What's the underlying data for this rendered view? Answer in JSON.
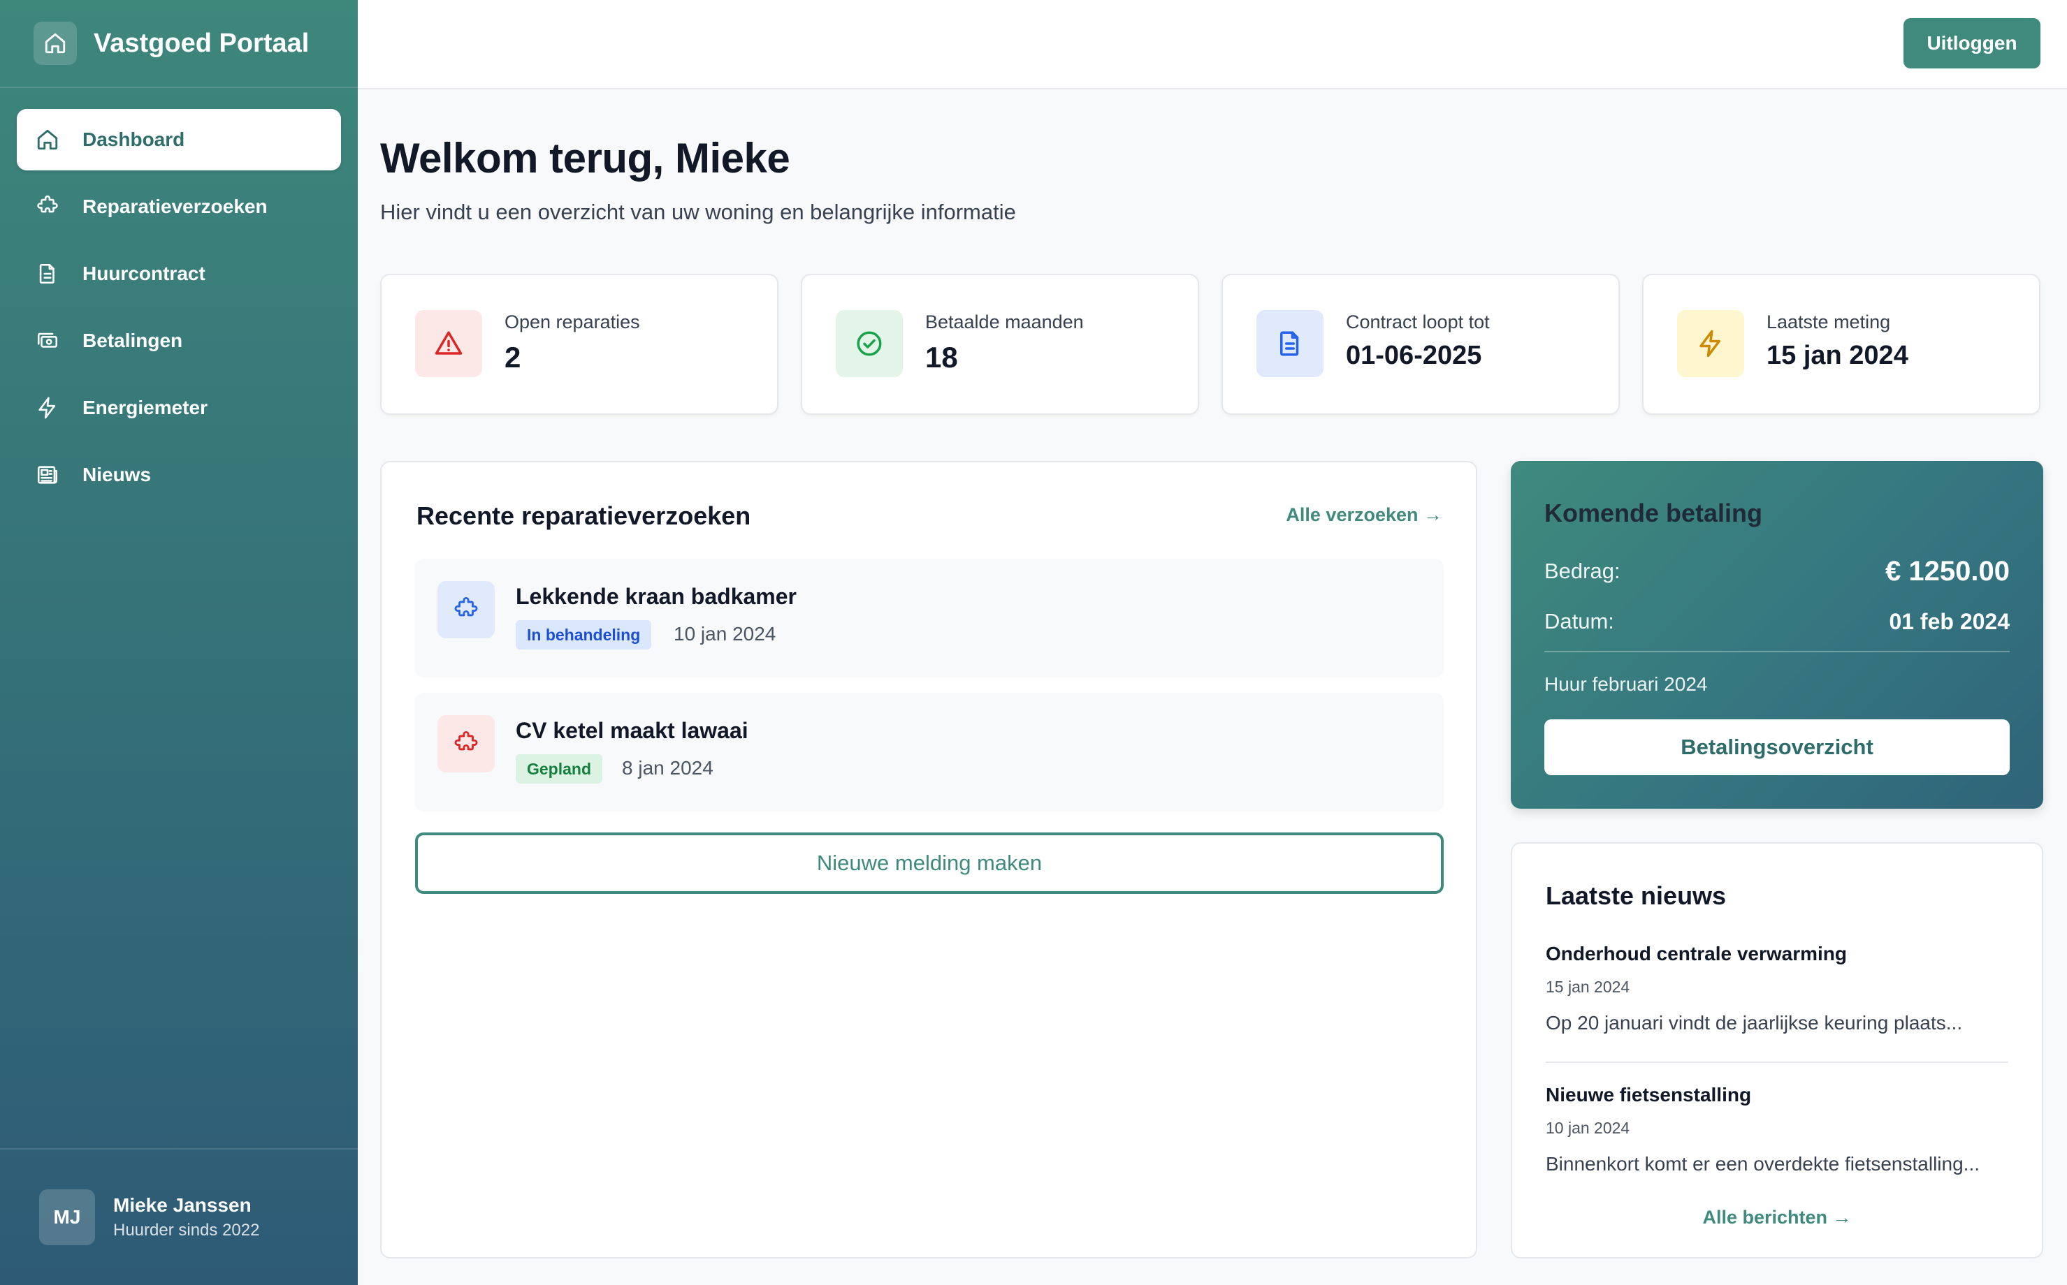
{
  "app": {
    "title": "Vastgoed Portaal",
    "icon": "home-icon"
  },
  "sidebar": {
    "items": [
      {
        "label": "Dashboard",
        "icon": "home-icon",
        "active": true
      },
      {
        "label": "Reparatieverzoeken",
        "icon": "puzzle-icon"
      },
      {
        "label": "Huurcontract",
        "icon": "document-icon"
      },
      {
        "label": "Betalingen",
        "icon": "money-icon"
      },
      {
        "label": "Energiemeter",
        "icon": "bolt-icon"
      },
      {
        "label": "Nieuws",
        "icon": "newspaper-icon"
      }
    ],
    "user": {
      "initials": "MJ",
      "name": "Mieke Janssen",
      "subtitle": "Huurder sinds 2022"
    }
  },
  "topbar": {
    "logout_label": "Uitloggen"
  },
  "welcome": {
    "title": "Welkom terug, Mieke",
    "subtitle": "Hier vindt u een overzicht van uw woning en belangrijke informatie"
  },
  "stats": [
    {
      "label": "Open reparaties",
      "value": "2",
      "icon": "alert-triangle-icon",
      "color": "#dc2626",
      "bg": "#fde8e8"
    },
    {
      "label": "Betaalde maanden",
      "value": "18",
      "icon": "check-circle-icon",
      "color": "#16a34a",
      "bg": "#e3f5e8"
    },
    {
      "label": "Contract loopt tot",
      "value": "01-06-2025",
      "icon": "document-icon",
      "color": "#2563eb",
      "bg": "#e1eafc"
    },
    {
      "label": "Laatste meting",
      "value": "15 jan 2024",
      "icon": "bolt-icon",
      "color": "#ca8a04",
      "bg": "#fdf6cf"
    }
  ],
  "repairs": {
    "title": "Recente reparatieverzoeken",
    "link": "Alle verzoeken →",
    "items": [
      {
        "title": "Lekkende kraan badkamer",
        "status": "In behandeling",
        "date": "10 jan 2024",
        "icon": "puzzle-icon",
        "icon_color": "#2563eb",
        "icon_bg": "#e1eafc",
        "badge_color": "#1d4ed8",
        "badge_bg": "#dbe7fd"
      },
      {
        "title": "CV ketel maakt lawaai",
        "status": "Gepland",
        "date": "8 jan 2024",
        "icon": "puzzle-icon",
        "icon_color": "#dc2626",
        "icon_bg": "#fde8e8",
        "badge_color": "#15803d",
        "badge_bg": "#dcf2e3"
      }
    ],
    "new_button": "Nieuwe melding maken"
  },
  "payment": {
    "title": "Komende betaling",
    "amount_label": "Bedrag:",
    "amount_value": "€ 1250.00",
    "date_label": "Datum:",
    "date_value": "01 feb 2024",
    "note": "Huur februari 2024",
    "button": "Betalingsoverzicht"
  },
  "news": {
    "title": "Laatste nieuws",
    "items": [
      {
        "title": "Onderhoud centrale verwarming",
        "date": "15 jan 2024",
        "text": "Op 20 januari vindt de jaarlijkse keuring plaats..."
      },
      {
        "title": "Nieuwe fietsenstalling",
        "date": "10 jan 2024",
        "text": "Binnenkort komt er een overdekte fietsenstalling..."
      }
    ],
    "link": "Alle berichten →"
  },
  "colors": {
    "accent": "#3f8a7d",
    "sidebar_top": "#3e877b",
    "sidebar_bottom": "#2e5a76"
  }
}
